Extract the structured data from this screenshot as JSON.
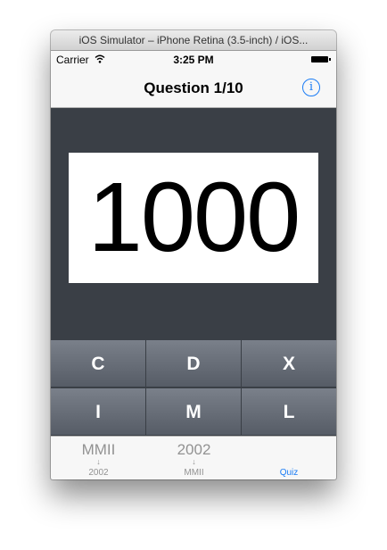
{
  "window": {
    "title": "iOS Simulator – iPhone Retina (3.5-inch) / iOS..."
  },
  "status_bar": {
    "carrier": "Carrier",
    "wifi_icon": "wifi-icon",
    "time": "3:25 PM",
    "battery_icon": "battery-icon"
  },
  "nav_bar": {
    "title": "Question 1/10",
    "info_icon": "info-icon",
    "info_glyph": "i"
  },
  "display": {
    "value": "1000"
  },
  "keypad": {
    "keys": [
      {
        "label": "C"
      },
      {
        "label": "D"
      },
      {
        "label": "X"
      },
      {
        "label": "I"
      },
      {
        "label": "M"
      },
      {
        "label": "L"
      }
    ]
  },
  "tab_bar": {
    "tabs": [
      {
        "top": "MMII",
        "arrow": "↓",
        "bottom": "2002",
        "selected": false
      },
      {
        "top": "2002",
        "arrow": "↓",
        "bottom": "MMII",
        "selected": false
      },
      {
        "top": "",
        "arrow": "",
        "bottom": "Quiz",
        "selected": true
      }
    ]
  },
  "colors": {
    "accent": "#1a7cf5",
    "screen_bg": "#3a3f46",
    "key_bg": "#60666f"
  }
}
